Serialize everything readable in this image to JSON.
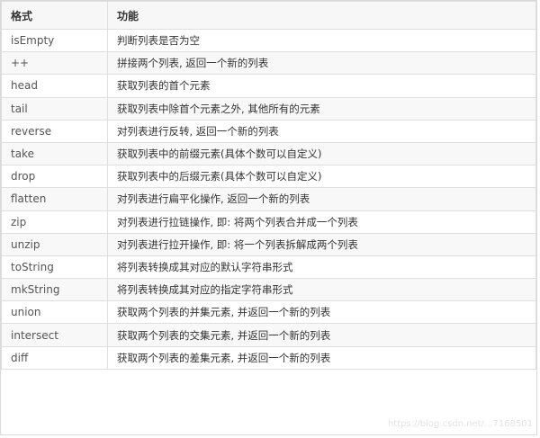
{
  "table": {
    "headers": {
      "format": "格式",
      "function": "功能"
    },
    "rows": [
      {
        "format": "isEmpty",
        "function": "判断列表是否为空"
      },
      {
        "format": "++",
        "function": "拼接两个列表, 返回一个新的列表"
      },
      {
        "format": "head",
        "function": "获取列表的首个元素"
      },
      {
        "format": "tail",
        "function": "获取列表中除首个元素之外, 其他所有的元素"
      },
      {
        "format": "reverse",
        "function": "对列表进行反转, 返回一个新的列表"
      },
      {
        "format": "take",
        "function": "获取列表中的前缀元素(具体个数可以自定义)"
      },
      {
        "format": "drop",
        "function": "获取列表中的后缀元素(具体个数可以自定义)"
      },
      {
        "format": "flatten",
        "function": "对列表进行扁平化操作, 返回一个新的列表"
      },
      {
        "format": "zip",
        "function": "对列表进行拉链操作, 即: 将两个列表合并成一个列表"
      },
      {
        "format": "unzip",
        "function": "对列表进行拉开操作, 即: 将一个列表拆解成两个列表"
      },
      {
        "format": "toString",
        "function": "将列表转换成其对应的默认字符串形式"
      },
      {
        "format": "mkString",
        "function": "将列表转换成其对应的指定字符串形式"
      },
      {
        "format": "union",
        "function": "获取两个列表的并集元素, 并返回一个新的列表"
      },
      {
        "format": "intersect",
        "function": "获取两个列表的交集元素, 并返回一个新的列表"
      },
      {
        "format": "diff",
        "function": "获取两个列表的差集元素, 并返回一个新的列表"
      }
    ]
  },
  "watermark": "https://blog.csdn.net/...7168501"
}
